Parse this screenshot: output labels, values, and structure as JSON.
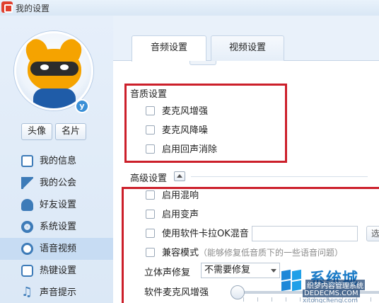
{
  "window": {
    "title": "我的设置"
  },
  "profile": {
    "avatar_badge": "y",
    "avatar_letter": "Y"
  },
  "profile_buttons": {
    "avatar": "头像",
    "card": "名片"
  },
  "sidebar": {
    "items": [
      {
        "label": "我的信息",
        "icon": "info-card-icon"
      },
      {
        "label": "我的公会",
        "icon": "flag-icon"
      },
      {
        "label": "好友设置",
        "icon": "friend-icon"
      },
      {
        "label": "系统设置",
        "icon": "gear-icon"
      },
      {
        "label": "语音视频",
        "icon": "speaker-icon",
        "active": true
      },
      {
        "label": "热键设置",
        "icon": "keyboard-icon"
      },
      {
        "label": "声音提示",
        "icon": "music-note-icon"
      }
    ]
  },
  "tabs": [
    {
      "label": "音频设置",
      "active": true
    },
    {
      "label": "视频设置",
      "active": false
    }
  ],
  "quality": {
    "title": "音质设置",
    "options": [
      {
        "label": "麦克风增强",
        "checked": false
      },
      {
        "label": "麦克风降噪",
        "checked": false
      },
      {
        "label": "启用回声消除",
        "checked": false
      }
    ]
  },
  "advanced": {
    "title": "高级设置",
    "options": [
      {
        "label": "启用混响",
        "checked": false
      },
      {
        "label": "启用变声",
        "checked": false
      },
      {
        "label": "使用软件卡拉OK混音",
        "checked": false
      },
      {
        "label": "兼容模式",
        "checked": false,
        "hint": "（能够修复低音质下的一些语音问题）"
      }
    ],
    "karaoke_button_label": "选",
    "stereo_label": "立体声修复",
    "stereo_value": "不需要修复",
    "mic_boost_label": "软件麦克风增强"
  },
  "watermark": {
    "brand": "系统城",
    "line1": "织梦内容管理系统",
    "line2": "DEDECMS.COM",
    "line3": "xitongcheng.com"
  },
  "colors": {
    "highlight": "#cc1f2a",
    "accent": "#3d7bb8",
    "active_nav": "#c7dcf3"
  }
}
